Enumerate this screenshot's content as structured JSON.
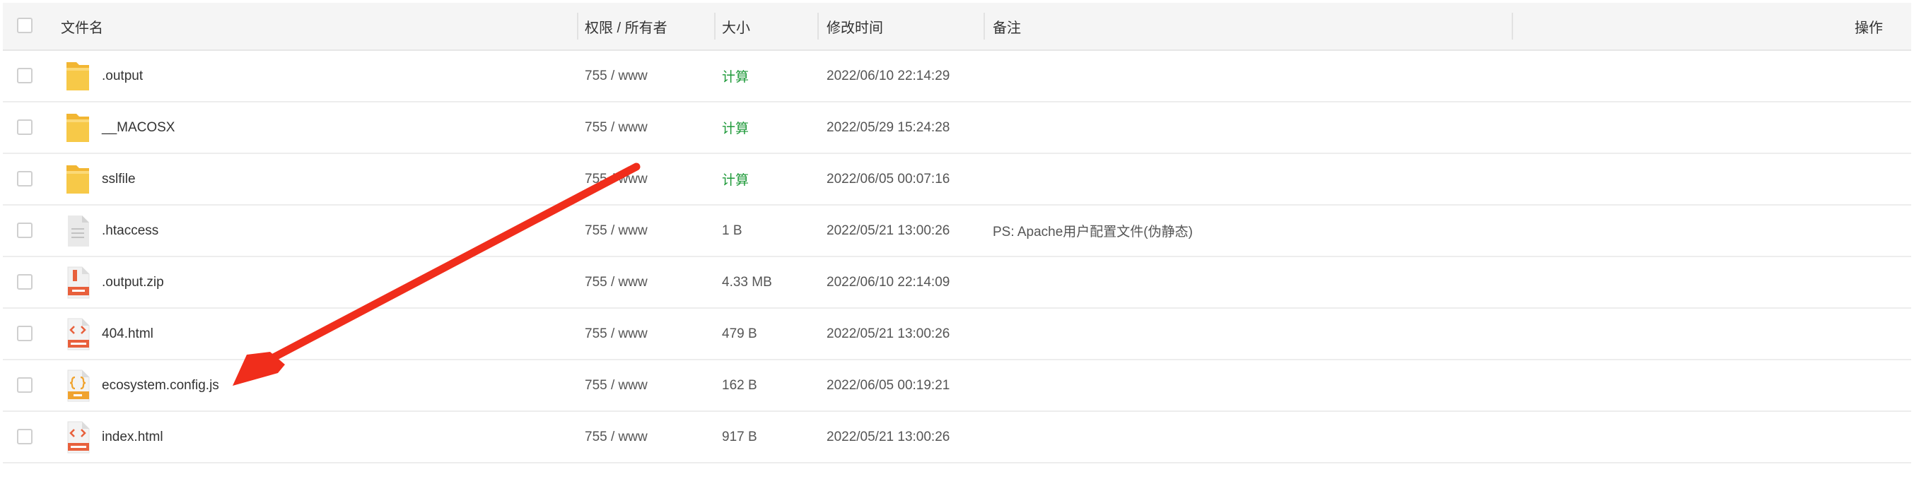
{
  "header": {
    "name": "文件名",
    "perm": "权限 / 所有者",
    "size": "大小",
    "time": "修改时间",
    "note": "备注",
    "ops": "操作"
  },
  "files": [
    {
      "name": ".output",
      "type": "folder",
      "perm": "755 / www",
      "size": "计算",
      "size_is_link": true,
      "time": "2022/06/10 22:14:29",
      "note": ""
    },
    {
      "name": "__MACOSX",
      "type": "folder",
      "perm": "755 / www",
      "size": "计算",
      "size_is_link": true,
      "time": "2022/05/29 15:24:28",
      "note": ""
    },
    {
      "name": "sslfile",
      "type": "folder",
      "perm": "755 / www",
      "size": "计算",
      "size_is_link": true,
      "time": "2022/06/05 00:07:16",
      "note": ""
    },
    {
      "name": ".htaccess",
      "type": "file",
      "perm": "755 / www",
      "size": "1 B",
      "size_is_link": false,
      "time": "2022/05/21 13:00:26",
      "note": "PS: Apache用户配置文件(伪静态)"
    },
    {
      "name": ".output.zip",
      "type": "zip",
      "perm": "755 / www",
      "size": "4.33 MB",
      "size_is_link": false,
      "time": "2022/06/10 22:14:09",
      "note": ""
    },
    {
      "name": "404.html",
      "type": "html",
      "perm": "755 / www",
      "size": "479 B",
      "size_is_link": false,
      "time": "2022/05/21 13:00:26",
      "note": ""
    },
    {
      "name": "ecosystem.config.js",
      "type": "js",
      "perm": "755 / www",
      "size": "162 B",
      "size_is_link": false,
      "time": "2022/06/05 00:19:21",
      "note": ""
    },
    {
      "name": "index.html",
      "type": "html",
      "perm": "755 / www",
      "size": "917 B",
      "size_is_link": false,
      "time": "2022/05/21 13:00:26",
      "note": ""
    }
  ],
  "colors": {
    "folder": "#f7c948",
    "calc_link": "#1f9a3a",
    "annotation_arrow": "#f02d1b"
  }
}
